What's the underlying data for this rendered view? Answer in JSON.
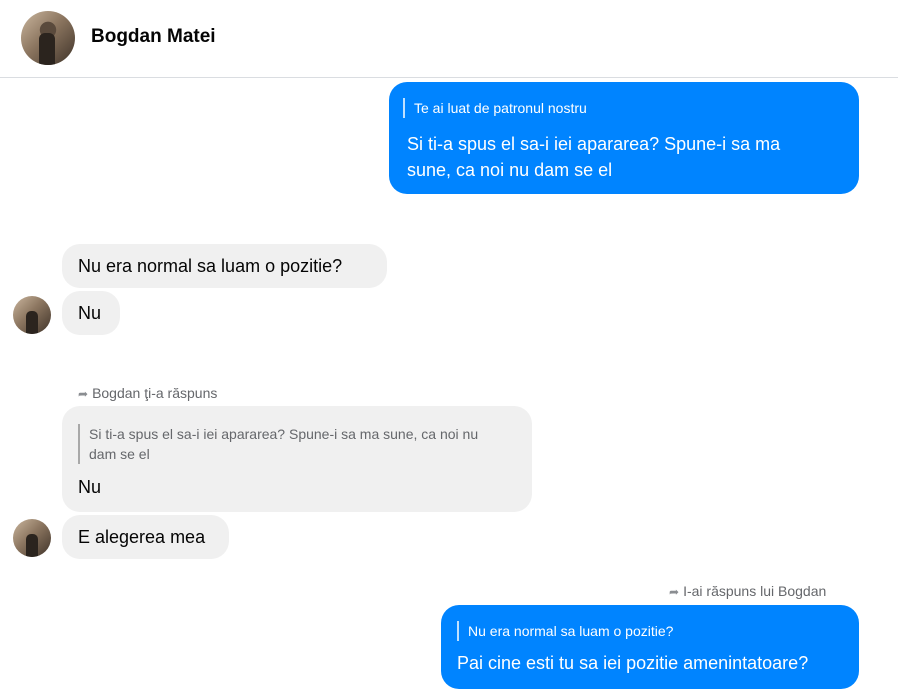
{
  "header": {
    "name": "Bogdan Matei"
  },
  "messages": {
    "m1": {
      "quote": "Te ai luat de patronul nostru",
      "text": "Si ti-a spus el sa-i iei apararea? Spune-i sa ma sune, ca noi nu dam se el"
    },
    "m2": {
      "text": "Nu era normal sa luam o pozitie?"
    },
    "m3": {
      "text": "Nu"
    },
    "m4": {
      "reply_note": "Bogdan ţi-a răspuns",
      "quote": "Si ti-a spus el sa-i iei apararea? Spune-i sa ma sune, ca noi nu dam se el",
      "text": "Nu"
    },
    "m5": {
      "text": "E alegerea mea"
    },
    "m6": {
      "reply_note": "I-ai răspuns lui Bogdan",
      "quote": "Nu era normal sa luam o pozitie?",
      "text": "Pai cine esti tu sa iei pozitie amenintatoare?"
    }
  },
  "icons": {
    "reply_arrow": "reply-arrow-icon",
    "avatar": "avatar"
  },
  "colors": {
    "outgoing_bubble": "#0084ff",
    "incoming_bubble": "#f0f0f0",
    "secondary_text": "#65676b"
  }
}
